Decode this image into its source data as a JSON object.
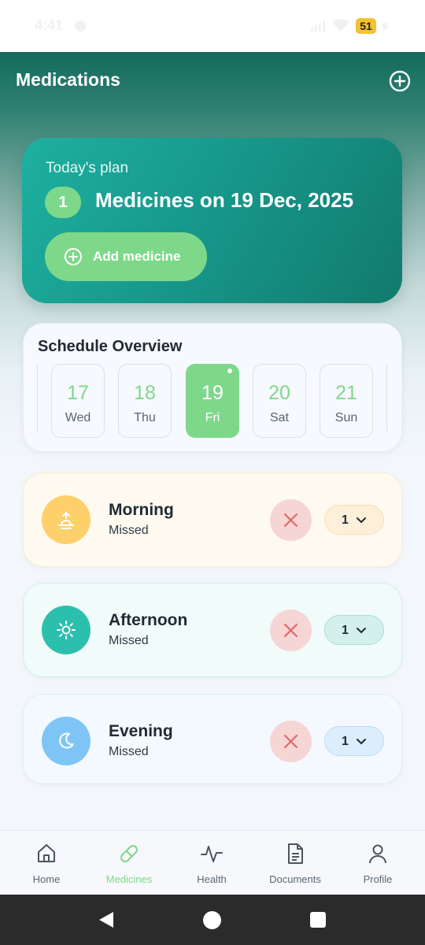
{
  "status_bar": {
    "time": "4:41",
    "battery": "51"
  },
  "header": {
    "title": "Medications"
  },
  "plan": {
    "label": "Today's plan",
    "count": "1",
    "text": "Medicines on 19 Dec, 2025",
    "add_label": "Add medicine"
  },
  "schedule": {
    "title": "Schedule Overview",
    "days": [
      {
        "num": "17",
        "name": "Wed"
      },
      {
        "num": "18",
        "name": "Thu"
      },
      {
        "num": "19",
        "name": "Fri"
      },
      {
        "num": "20",
        "name": "Sat"
      },
      {
        "num": "21",
        "name": "Sun"
      }
    ],
    "selected_day": "19"
  },
  "slots": [
    {
      "name": "Morning",
      "status": "Missed",
      "qty": "1"
    },
    {
      "name": "Afternoon",
      "status": "Missed",
      "qty": "1"
    },
    {
      "name": "Evening",
      "status": "Missed",
      "qty": "1"
    }
  ],
  "nav": [
    {
      "label": "Home",
      "icon": "home-icon"
    },
    {
      "label": "Medicines",
      "icon": "pill-icon"
    },
    {
      "label": "Health",
      "icon": "activity-icon"
    },
    {
      "label": "Documents",
      "icon": "document-icon"
    },
    {
      "label": "Profile",
      "icon": "user-icon"
    }
  ],
  "nav_active": "Medicines",
  "colors": {
    "accent_green": "#7ed88a",
    "teal": "#17998c",
    "morning": "#fdd06b",
    "afternoon": "#2dbfae",
    "evening": "#7ec5f6",
    "missed": "#e06868"
  }
}
